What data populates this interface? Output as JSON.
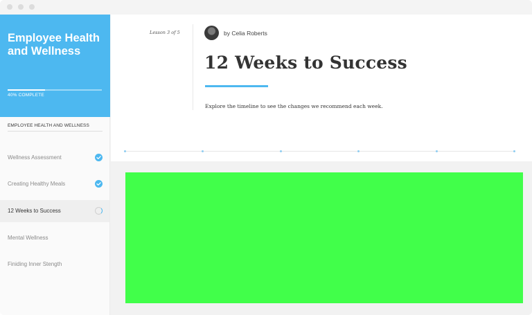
{
  "course": {
    "title": "Employee Health and Wellness",
    "progress_percent": 40,
    "progress_label": "40% COMPLETE"
  },
  "sidebar": {
    "section_title": "EMPLOYEE HEALTH AND WELLNESS",
    "lessons": [
      {
        "label": "Wellness Assessment",
        "status": "complete",
        "status_icon": "check-circle-icon"
      },
      {
        "label": "Creating Healthy Meals",
        "status": "complete",
        "status_icon": "check-circle-icon"
      },
      {
        "label": "12 Weeks to Success",
        "status": "in-progress",
        "status_icon": "progress-ring-icon"
      },
      {
        "label": "Mental Wellness",
        "status": "not-started",
        "status_icon": ""
      },
      {
        "label": "Finiding Inner Stength",
        "status": "not-started",
        "status_icon": ""
      }
    ]
  },
  "lesson": {
    "counter": "Lesson 3 of 5",
    "author": "by Celia Roberts",
    "title": "12 Weeks to Success",
    "description": "Explore the timeline to see the changes we recommend each week."
  },
  "timeline": {
    "points": 6
  },
  "colors": {
    "accent": "#4db8f0",
    "media_placeholder": "#41ff4a",
    "sidebar_active": "#efefef"
  }
}
